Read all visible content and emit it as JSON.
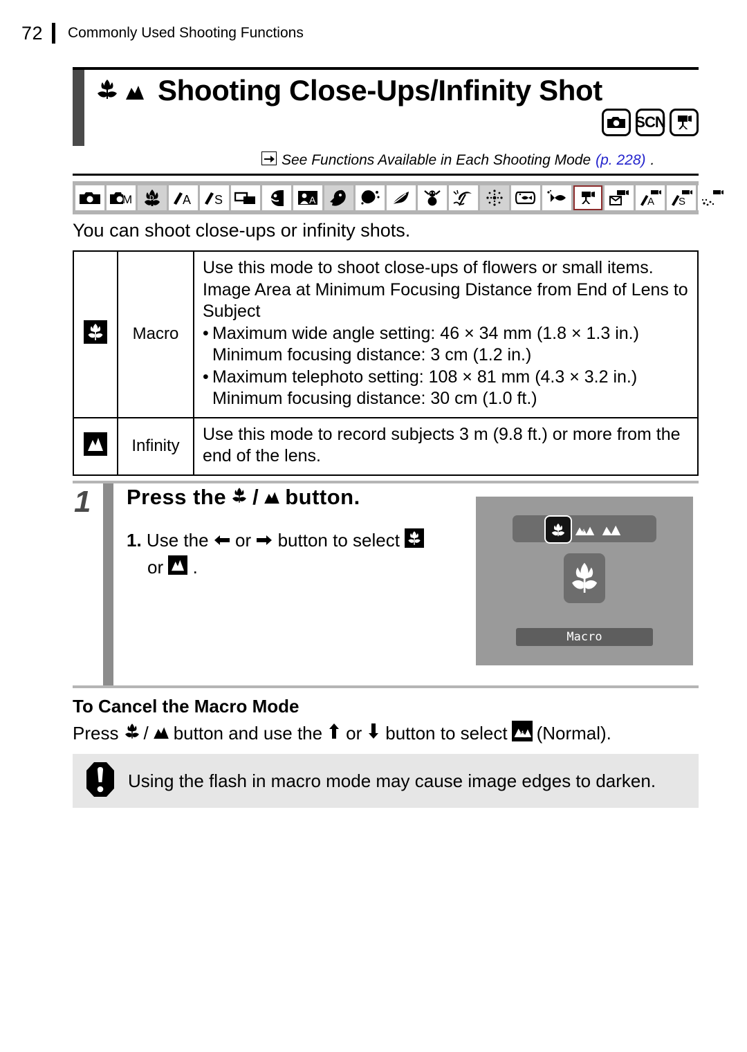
{
  "header": {
    "page_number": "72",
    "chapter": "Commonly Used Shooting Functions"
  },
  "title": {
    "text": "Shooting Close-Ups/Infinity Shot",
    "leading_icons": [
      "macro-flower-icon",
      "infinity-mountain-icon"
    ],
    "mode_badges": [
      "still-camera-icon",
      "SCN",
      "movie-camera-icon"
    ]
  },
  "cross_reference": {
    "arrow": "➔",
    "text": "See Functions Available in Each Shooting Mode",
    "page_link": "(p. 228)",
    "trailing": ".",
    "link_color": "#2222cc"
  },
  "mode_strip": {
    "band_color": "#b3b3b3",
    "icons": [
      {
        "name": "auto-camera-icon",
        "state": "available"
      },
      {
        "name": "manual-M-icon",
        "state": "available"
      },
      {
        "name": "digital-macro-icon",
        "state": "dimmed"
      },
      {
        "name": "aperture-priority-Av-icon",
        "state": "available"
      },
      {
        "name": "shutter-priority-Tv-icon",
        "state": "available"
      },
      {
        "name": "stitch-assist-icon",
        "state": "available"
      },
      {
        "name": "portrait-icon",
        "state": "available"
      },
      {
        "name": "night-snapshot-icon",
        "state": "available"
      },
      {
        "name": "kids-and-pets-icon",
        "state": "dimmed"
      },
      {
        "name": "indoor-icon",
        "state": "available"
      },
      {
        "name": "foliage-icon",
        "state": "available"
      },
      {
        "name": "snow-icon",
        "state": "available"
      },
      {
        "name": "beach-icon",
        "state": "available"
      },
      {
        "name": "fireworks-icon",
        "state": "dimmed"
      },
      {
        "name": "aquarium-icon",
        "state": "available"
      },
      {
        "name": "underwater-icon",
        "state": "available"
      },
      {
        "name": "movie-standard-icon",
        "state": "selected"
      },
      {
        "name": "movie-compact-icon",
        "state": "available"
      },
      {
        "name": "movie-color-accent-icon",
        "state": "available"
      },
      {
        "name": "movie-color-swap-icon",
        "state": "available"
      },
      {
        "name": "movie-time-lapse-icon",
        "state": "available"
      }
    ],
    "selected_border_color": "#8b2b2b"
  },
  "intro": "You can shoot close-ups or infinity shots.",
  "table": {
    "rows": [
      {
        "icon": "macro-flower-icon",
        "mode": "Macro",
        "lead": "Use this mode to shoot close-ups of flowers or small items. Image Area at Minimum Focusing Distance from End of Lens to Subject",
        "bullets": [
          "Maximum wide angle setting: 46 × 34 mm (1.8 × 1.3 in.) Minimum focusing distance: 3 cm (1.2 in.)",
          "Maximum telephoto setting: 108 × 81 mm (4.3 × 3.2 in.) Minimum focusing distance: 30 cm (1.0 ft.)"
        ]
      },
      {
        "icon": "infinity-mountain-icon",
        "mode": "Infinity",
        "lead": "Use this mode to record subjects 3 m (9.8 ft.) or more from the end of the lens.",
        "bullets": []
      }
    ]
  },
  "step": {
    "number": "1",
    "title_pre": "Press the",
    "title_icons": [
      "macro-flower-icon",
      "infinity-mountain-icon"
    ],
    "title_sep": "/",
    "title_post": "button.",
    "substep_number": "1.",
    "substep_pre": "Use the",
    "arrow_left": "⬅",
    "substep_or": "or",
    "arrow_right": "➡",
    "substep_mid": "button to select",
    "substep_or2": "or",
    "substep_end": "."
  },
  "lcd": {
    "options": [
      {
        "name": "macro-flower-icon",
        "selected": true
      },
      {
        "name": "normal-af-icon",
        "selected": false
      },
      {
        "name": "infinity-mountain-icon",
        "selected": false
      }
    ],
    "big_icon": "macro-flower-icon",
    "label": "Macro",
    "background_color": "#9a9a9a"
  },
  "cancel": {
    "heading": "To Cancel the Macro Mode",
    "pre": "Press",
    "icon_macro": "macro-flower-icon",
    "sep": "/",
    "icon_infinity": "infinity-mountain-icon",
    "mid": "button and use the",
    "arrow_up": "⬆",
    "or": "or",
    "arrow_down": "⬇",
    "mid2": "button to select",
    "icon_normal": "normal-af-icon",
    "end": "(Normal)."
  },
  "note": {
    "icon": "exclamation-octagon-icon",
    "text": "Using the flash in macro mode may cause image edges to darken.",
    "background_color": "#e6e6e6"
  }
}
